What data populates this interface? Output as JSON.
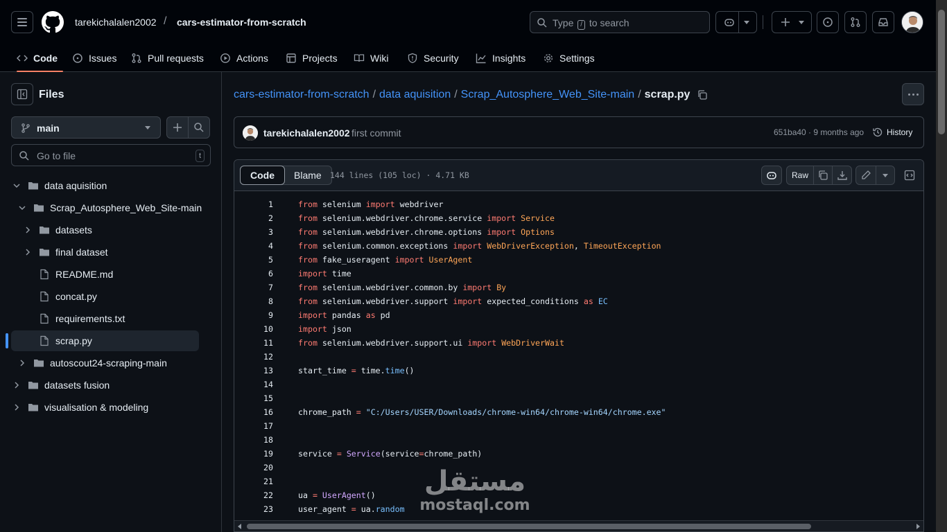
{
  "header": {
    "owner": "tarekichalalen2002",
    "slash": "/",
    "repo": "cars-estimator-from-scratch",
    "search_prefix": "Type",
    "search_key": "/",
    "search_suffix": "to search"
  },
  "nav": {
    "tabs": [
      {
        "label": "Code",
        "icon": "code-icon"
      },
      {
        "label": "Issues",
        "icon": "issue-icon"
      },
      {
        "label": "Pull requests",
        "icon": "pull-request-icon"
      },
      {
        "label": "Actions",
        "icon": "play-icon"
      },
      {
        "label": "Projects",
        "icon": "table-icon"
      },
      {
        "label": "Wiki",
        "icon": "book-icon"
      },
      {
        "label": "Security",
        "icon": "shield-icon"
      },
      {
        "label": "Insights",
        "icon": "graph-icon"
      },
      {
        "label": "Settings",
        "icon": "gear-icon"
      }
    ]
  },
  "sidebar": {
    "title": "Files",
    "branch": "main",
    "goto_placeholder": "Go to file",
    "goto_key": "t",
    "tree": [
      {
        "label": "data aquisition",
        "type": "folder",
        "expanded": true
      },
      {
        "label": "Scrap_Autosphere_Web_Site-main",
        "type": "folder",
        "expanded": true
      },
      {
        "label": "datasets",
        "type": "folder",
        "expanded": false
      },
      {
        "label": "final dataset",
        "type": "folder",
        "expanded": false
      },
      {
        "label": "README.md",
        "type": "file"
      },
      {
        "label": "concat.py",
        "type": "file"
      },
      {
        "label": "requirements.txt",
        "type": "file"
      },
      {
        "label": "scrap.py",
        "type": "file",
        "selected": true
      },
      {
        "label": "autoscout24-scraping-main",
        "type": "folder",
        "expanded": false
      },
      {
        "label": "datasets fusion",
        "type": "folder",
        "expanded": false
      },
      {
        "label": "visualisation & modeling",
        "type": "folder",
        "expanded": false
      }
    ]
  },
  "path": {
    "parts": [
      "cars-estimator-from-scratch",
      "data aquisition",
      "Scrap_Autosphere_Web_Site-main"
    ],
    "sep": "/",
    "current": "scrap.py"
  },
  "commit": {
    "author": "tarekichalalen2002",
    "message": "first commit",
    "meta": "651ba40 · 9 months ago",
    "history": "History"
  },
  "code": {
    "tab_code": "Code",
    "tab_blame": "Blame",
    "info": "144 lines (105 loc) · 4.71 KB",
    "raw": "Raw",
    "lines": [
      [
        [
          "k",
          "from"
        ],
        [
          "t",
          " selenium "
        ],
        [
          "k",
          "import"
        ],
        [
          "t",
          " webdriver"
        ]
      ],
      [
        [
          "k",
          "from"
        ],
        [
          "t",
          " selenium.webdriver.chrome.service "
        ],
        [
          "k",
          "import"
        ],
        [
          "t",
          " "
        ],
        [
          "c",
          "Service"
        ]
      ],
      [
        [
          "k",
          "from"
        ],
        [
          "t",
          " selenium.webdriver.chrome.options "
        ],
        [
          "k",
          "import"
        ],
        [
          "t",
          " "
        ],
        [
          "c",
          "Options"
        ]
      ],
      [
        [
          "k",
          "from"
        ],
        [
          "t",
          " selenium.common.exceptions "
        ],
        [
          "k",
          "import"
        ],
        [
          "t",
          " "
        ],
        [
          "c",
          "WebDriverException"
        ],
        [
          "t",
          ", "
        ],
        [
          "c",
          "TimeoutException"
        ]
      ],
      [
        [
          "k",
          "from"
        ],
        [
          "t",
          " fake_useragent "
        ],
        [
          "k",
          "import"
        ],
        [
          "t",
          " "
        ],
        [
          "c",
          "UserAgent"
        ]
      ],
      [
        [
          "k",
          "import"
        ],
        [
          "t",
          " time"
        ]
      ],
      [
        [
          "k",
          "from"
        ],
        [
          "t",
          " selenium.webdriver.common.by "
        ],
        [
          "k",
          "import"
        ],
        [
          "t",
          " "
        ],
        [
          "c",
          "By"
        ]
      ],
      [
        [
          "k",
          "from"
        ],
        [
          "t",
          " selenium.webdriver.support "
        ],
        [
          "k",
          "import"
        ],
        [
          "t",
          " expected_conditions "
        ],
        [
          "k",
          "as"
        ],
        [
          "t",
          " "
        ],
        [
          "b",
          "EC"
        ]
      ],
      [
        [
          "k",
          "import"
        ],
        [
          "t",
          " pandas "
        ],
        [
          "k",
          "as"
        ],
        [
          "t",
          " pd"
        ]
      ],
      [
        [
          "k",
          "import"
        ],
        [
          "t",
          " json"
        ]
      ],
      [
        [
          "k",
          "from"
        ],
        [
          "t",
          " selenium.webdriver.support.ui "
        ],
        [
          "k",
          "import"
        ],
        [
          "t",
          " "
        ],
        [
          "c",
          "WebDriverWait"
        ]
      ],
      [],
      [
        [
          "t",
          "start_time "
        ],
        [
          "k",
          "="
        ],
        [
          "t",
          " time."
        ],
        [
          "b",
          "time"
        ],
        [
          "t",
          "()"
        ]
      ],
      [],
      [],
      [
        [
          "t",
          "chrome_path "
        ],
        [
          "k",
          "="
        ],
        [
          "t",
          " "
        ],
        [
          "s",
          "\"C:/Users/USER/Downloads/chrome-win64/chrome-win64/chrome.exe\""
        ]
      ],
      [],
      [],
      [
        [
          "t",
          "service "
        ],
        [
          "k",
          "="
        ],
        [
          "t",
          " "
        ],
        [
          "f",
          "Service"
        ],
        [
          "t",
          "(service"
        ],
        [
          "k",
          "="
        ],
        [
          "t",
          "chrome_path)"
        ]
      ],
      [],
      [],
      [
        [
          "t",
          "ua "
        ],
        [
          "k",
          "="
        ],
        [
          "t",
          " "
        ],
        [
          "f",
          "UserAgent"
        ],
        [
          "t",
          "()"
        ]
      ],
      [
        [
          "t",
          "user_agent "
        ],
        [
          "k",
          "="
        ],
        [
          "t",
          " ua."
        ],
        [
          "b",
          "random"
        ]
      ]
    ]
  },
  "watermark": {
    "arabic": "مستقل",
    "latin": "mostaql.com"
  },
  "colors": {
    "accent_tab": "#f78166",
    "link": "#4493f8",
    "background": "#0d1117"
  }
}
